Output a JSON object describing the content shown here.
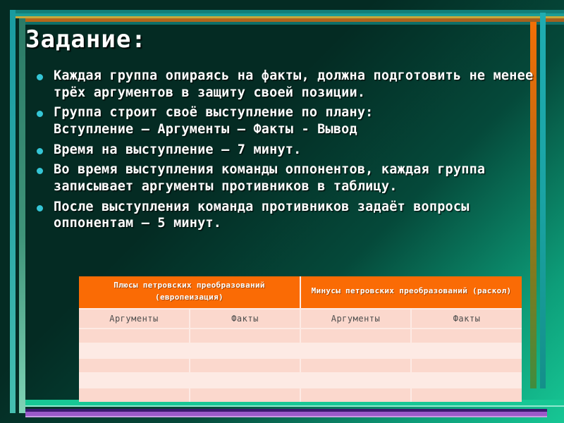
{
  "slide": {
    "title": "Задание:",
    "bullets": [
      "Каждая группа опираясь на факты, должна подготовить не менее трёх аргументов в защиту своей позиции.",
      "Группа строит своё выступление по плану:\nВступление – Аргументы – Факты - Вывод",
      "Время на выступление – 7 минут.",
      "Во время выступления команды оппонентов, каждая группа записывает аргументы противников в таблицу.",
      "После выступления команда противников задаёт вопросы оппонентам – 5 минут."
    ],
    "table": {
      "group_headers": [
        "Плюсы петровских преобразований (европеизация)",
        "Минусы петровских преобразований (раскол)"
      ],
      "sub_headers": [
        "Аргументы",
        "Факты",
        "Аргументы",
        "Факты"
      ],
      "empty_rows": 5
    },
    "colors": {
      "background_dark": "#042b23",
      "background_accent": "#17c795",
      "header_orange": "#fa6b05",
      "cell_pink": "#fbd8cd",
      "cell_pink_light": "#fdeae4",
      "bullet_dot": "#35c6d6",
      "text": "#ffffff",
      "bottom_purple": "#9b59c9",
      "frame_cyan": "#1fadb2",
      "frame_gold": "#c6a93b"
    }
  }
}
